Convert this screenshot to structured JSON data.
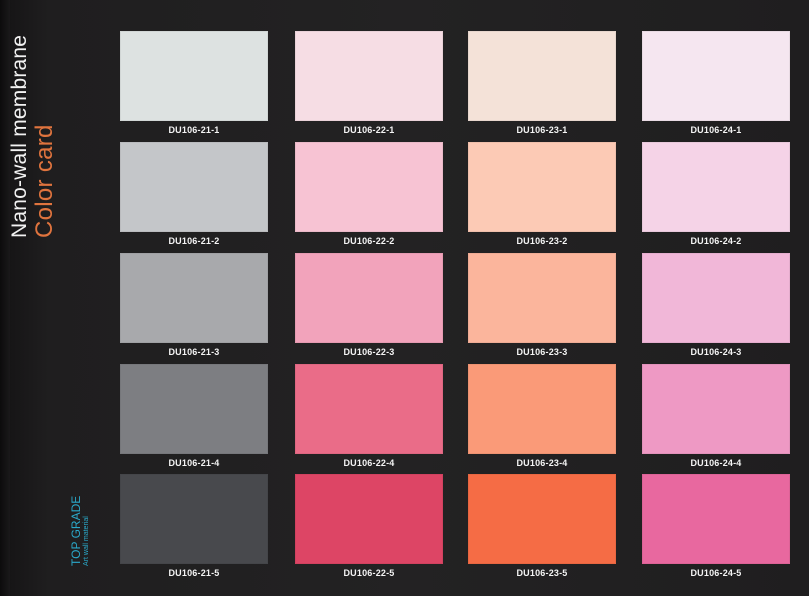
{
  "title_line1": "Nano-wall membrane",
  "title_line2": "Color card",
  "grade_line1": "TOP GRADE",
  "grade_line2": "Art wall material",
  "columns": [
    {
      "swatches": [
        {
          "code": "DU106-21-1",
          "color": "#dde2e1"
        },
        {
          "code": "DU106-21-2",
          "color": "#c4c6c9"
        },
        {
          "code": "DU106-21-3",
          "color": "#a8a9ac"
        },
        {
          "code": "DU106-21-4",
          "color": "#7d7e82"
        },
        {
          "code": "DU106-21-5",
          "color": "#48494d"
        }
      ]
    },
    {
      "swatches": [
        {
          "code": "DU106-22-1",
          "color": "#f6dde4"
        },
        {
          "code": "DU106-22-2",
          "color": "#f7c3d3"
        },
        {
          "code": "DU106-22-3",
          "color": "#f2a3bb"
        },
        {
          "code": "DU106-22-4",
          "color": "#ea6c88"
        },
        {
          "code": "DU106-22-5",
          "color": "#dd4565"
        }
      ]
    },
    {
      "swatches": [
        {
          "code": "DU106-23-1",
          "color": "#f4e2d8"
        },
        {
          "code": "DU106-23-2",
          "color": "#fccab5"
        },
        {
          "code": "DU106-23-3",
          "color": "#fbb59c"
        },
        {
          "code": "DU106-23-4",
          "color": "#fa9a78"
        },
        {
          "code": "DU106-23-5",
          "color": "#f56c45"
        }
      ]
    },
    {
      "swatches": [
        {
          "code": "DU106-24-1",
          "color": "#f5e6f0"
        },
        {
          "code": "DU106-24-2",
          "color": "#f5d3e7"
        },
        {
          "code": "DU106-24-3",
          "color": "#f1b7d8"
        },
        {
          "code": "DU106-24-4",
          "color": "#ee99c4"
        },
        {
          "code": "DU106-24-5",
          "color": "#e8689f"
        }
      ]
    }
  ]
}
